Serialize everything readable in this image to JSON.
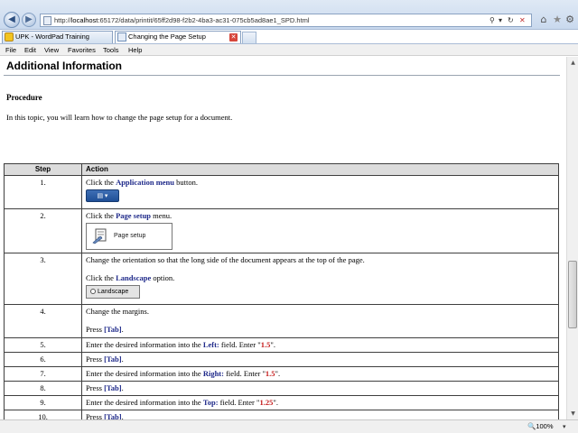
{
  "browser": {
    "url_prefix": "http://",
    "url_host": "localhost",
    "url_rest": ":65172/data/printit/65ff2d98-f2b2-4ba3-ac31-075cb5ad8ae1_SPD.html",
    "tabs": [
      {
        "label": "UPK - WordPad Training"
      },
      {
        "label": "Changing the Page Setup"
      }
    ],
    "menu": [
      "File",
      "Edit",
      "View",
      "Favorites",
      "Tools",
      "Help"
    ],
    "icons": {
      "back": "back-arrow-icon",
      "forward": "forward-arrow-icon",
      "home": "home-icon",
      "favorites": "star-icon",
      "tools": "gear-icon"
    },
    "zoom": "100%"
  },
  "page": {
    "title": "Additional Information",
    "procedure_heading": "Procedure",
    "intro": "In this topic, you will learn how to change the page setup for a document.",
    "table": {
      "headers": [
        "Step",
        "Action"
      ],
      "rows": [
        {
          "step": "1.",
          "parts": [
            "Click the ",
            "Application menu",
            " button."
          ]
        },
        {
          "step": "2.",
          "parts": [
            "Click the ",
            "Page setup",
            " menu."
          ],
          "thumb_label": "Page setup"
        },
        {
          "step": "3.",
          "line1": "Change the orientation so that the long side of the document appears at the top of the page.",
          "parts": [
            "Click the ",
            "Landscape",
            " option."
          ],
          "thumb_label": "Landscape"
        },
        {
          "step": "4.",
          "line1": "Change the margins.",
          "parts": [
            "Press ",
            "[Tab]",
            "."
          ]
        },
        {
          "step": "5.",
          "parts": [
            "Enter the desired information into the ",
            "Left:",
            " field. Enter \"",
            "1.5",
            "\"."
          ]
        },
        {
          "step": "6.",
          "parts": [
            "Press ",
            "[Tab]",
            "."
          ]
        },
        {
          "step": "7.",
          "parts": [
            "Enter the desired information into the ",
            "Right:",
            " field. Enter \"",
            "1.5",
            "\"."
          ]
        },
        {
          "step": "8.",
          "parts": [
            "Press ",
            "[Tab]",
            "."
          ]
        },
        {
          "step": "9.",
          "parts": [
            "Enter the desired information into the ",
            "Top:",
            " field. Enter \"",
            "1.25",
            "\"."
          ]
        },
        {
          "step": "10.",
          "parts": [
            "Press ",
            "[Tab]",
            "."
          ]
        }
      ]
    }
  },
  "colors": {
    "emphasis": "#1f2a8a",
    "value": "#c41a1a",
    "header_bg": "#dcdcdc"
  }
}
